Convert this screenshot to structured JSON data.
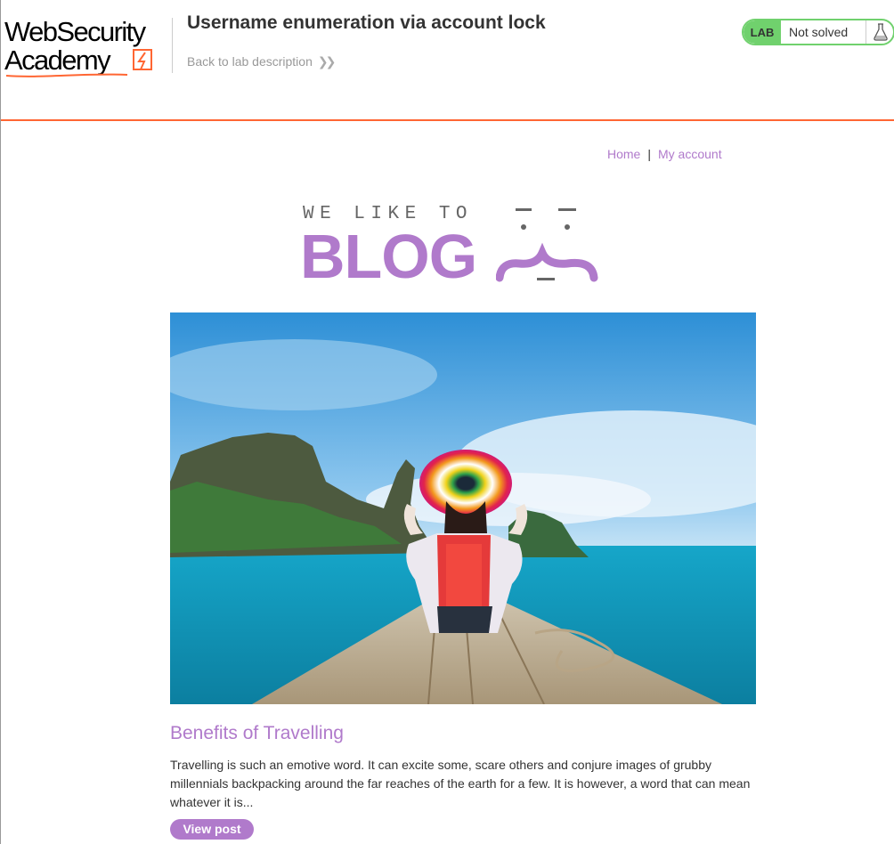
{
  "header": {
    "logo": {
      "line1": "WebSecurity",
      "line2": "Academy"
    },
    "lab_title": "Username enumeration via account lock",
    "back_link": "Back to lab description",
    "status": {
      "badge": "LAB",
      "text": "Not solved",
      "icon": "flask-icon"
    }
  },
  "nav": {
    "home": "Home",
    "separator": "|",
    "my_account": "My account"
  },
  "banner": {
    "tagline": "WE LIKE TO",
    "blog": "BLOG"
  },
  "post": {
    "image_alt": "woman in a rainbow hat sitting on the bow of a boat",
    "title": "Benefits of Travelling",
    "excerpt": "Travelling is such an emotive word. It can excite some, scare others and conjure images of grubby millennials backpacking around the far reaches of the earth for a few. It is however, a word that can mean whatever it is...",
    "button": "View post"
  },
  "colors": {
    "accent": "#b07acb",
    "lab_green": "#70d16d",
    "header_border": "#ff6633"
  }
}
